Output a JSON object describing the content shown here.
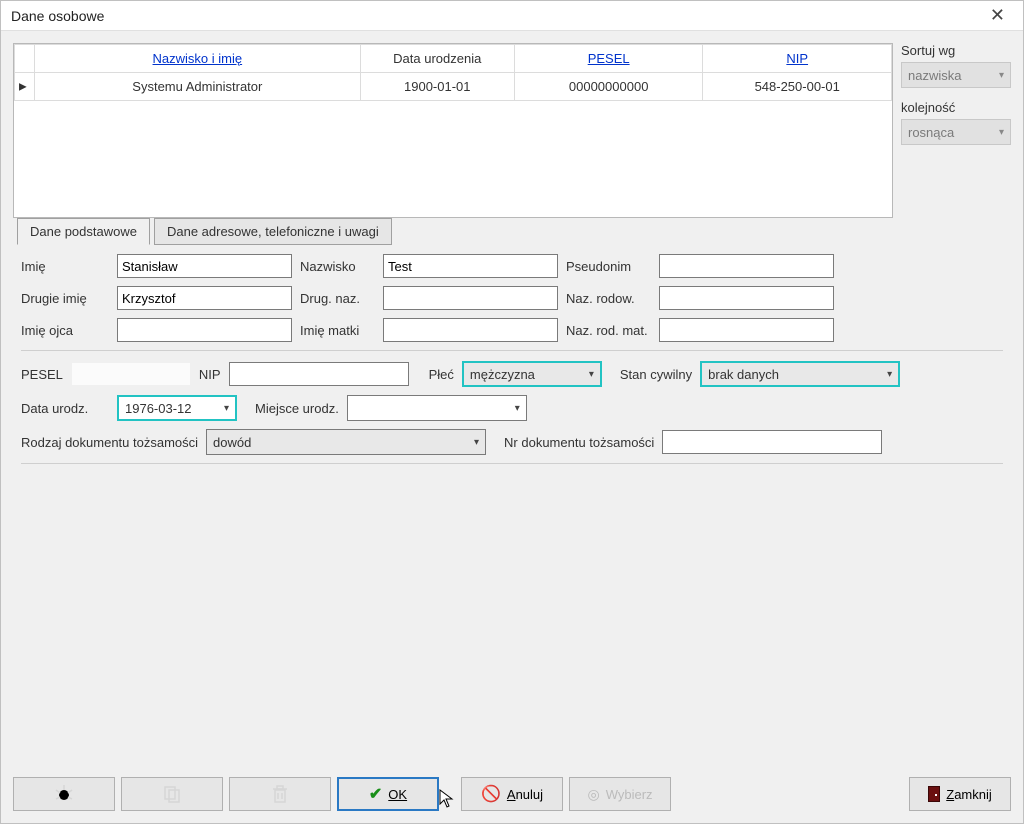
{
  "window": {
    "title": "Dane osobowe"
  },
  "grid": {
    "headers": {
      "name": "Nazwisko i imię",
      "birth": "Data urodzenia",
      "pesel": "PESEL",
      "nip": "NIP"
    },
    "row": {
      "name": "Systemu Administrator",
      "birth": "1900-01-01",
      "pesel": "00000000000",
      "nip": "548-250-00-01"
    }
  },
  "side": {
    "sort_label": "Sortuj wg",
    "sort_value": "nazwiska",
    "order_label": "kolejność",
    "order_value": "rosnąca"
  },
  "tabs": {
    "basic": "Dane podstawowe",
    "address": "Dane adresowe, telefoniczne i uwagi"
  },
  "form": {
    "imie_l": "Imię",
    "imie_v": "Stanisław",
    "nazwisko_l": "Nazwisko",
    "nazwisko_v": "Test",
    "pseudonim_l": "Pseudonim",
    "drugieimie_l": "Drugie imię",
    "drugieimie_v": "Krzysztof",
    "drugnaz_l": "Drug. naz.",
    "nazrodow_l": "Naz. rodow.",
    "imieojca_l": "Imię ojca",
    "imiematki_l": "Imię matki",
    "nazrodmat_l": "Naz. rod. mat.",
    "pesel_l": "PESEL",
    "nip_l": "NIP",
    "plec_l": "Płeć",
    "plec_v": "mężczyzna",
    "stan_l": "Stan cywilny",
    "stan_v": "brak danych",
    "dataurodz_l": "Data urodz.",
    "dataurodz_v": "1976-03-12",
    "miejsce_l": "Miejsce urodz.",
    "rodzajdok_l": "Rodzaj dokumentu tożsamości",
    "rodzajdok_v": "dowód",
    "nrdok_l": "Nr dokumentu tożsamości"
  },
  "footer": {
    "ok": "OK",
    "anuluj": "Anuluj",
    "wybierz": "Wybierz",
    "zamknij": "Zamknij"
  }
}
